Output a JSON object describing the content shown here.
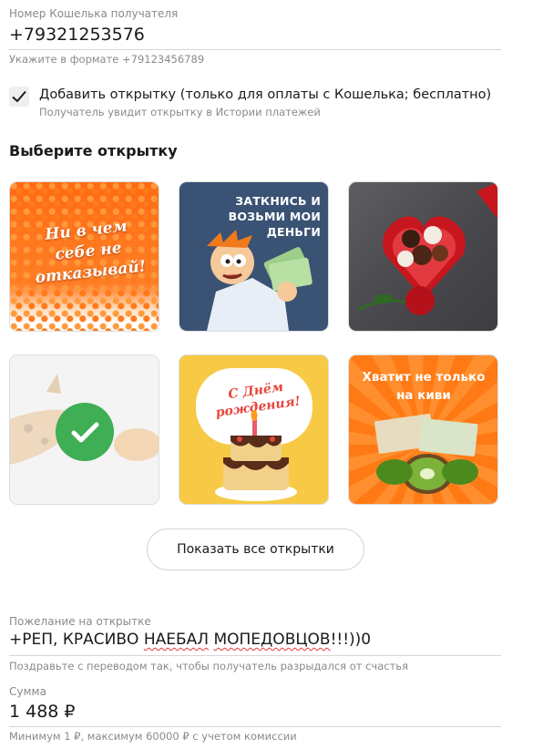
{
  "recipient": {
    "label": "Номер Кошелька получателя",
    "value": "+79321253576",
    "hint": "Укажите в формате +79123456789"
  },
  "postcard_option": {
    "checked": true,
    "label": "Добавить открытку (только для оплаты с Кошелька; бесплатно)",
    "hint": "Получатель увидит открытку в Истории платежей"
  },
  "cards_section": {
    "title": "Выберите открытку",
    "cards": [
      {
        "id": "caviar",
        "text": "Ни в чем себе не отказывай!"
      },
      {
        "id": "money",
        "text": "ЗАТКНИСЬ И ВОЗЬМИ МОИ ДЕНЬГИ"
      },
      {
        "id": "chocolates",
        "text": ""
      },
      {
        "id": "giraffe",
        "text": "",
        "selected": true
      },
      {
        "id": "birthday",
        "text": "С Днём рождения!"
      },
      {
        "id": "kiwi",
        "text": "Хватит не только на киви"
      }
    ],
    "show_all": "Показать все открытки"
  },
  "wish": {
    "label": "Пожелание на открытке",
    "parts": [
      "+РЕП, КРАСИВО ",
      "НАЕБАЛ",
      " ",
      "МОПЕДОВЦОВ",
      "!!!))0"
    ],
    "hint": "Поздравьте с переводом так, чтобы получатель разрыдался от счастья"
  },
  "amount": {
    "label": "Сумма",
    "value": "1 488 ₽",
    "hint": "Минимум 1 ₽, максимум 60000 ₽ с учетом комиссии"
  },
  "colors": {
    "selected_check": "#3fae55",
    "spellcheck": "#e53935"
  }
}
